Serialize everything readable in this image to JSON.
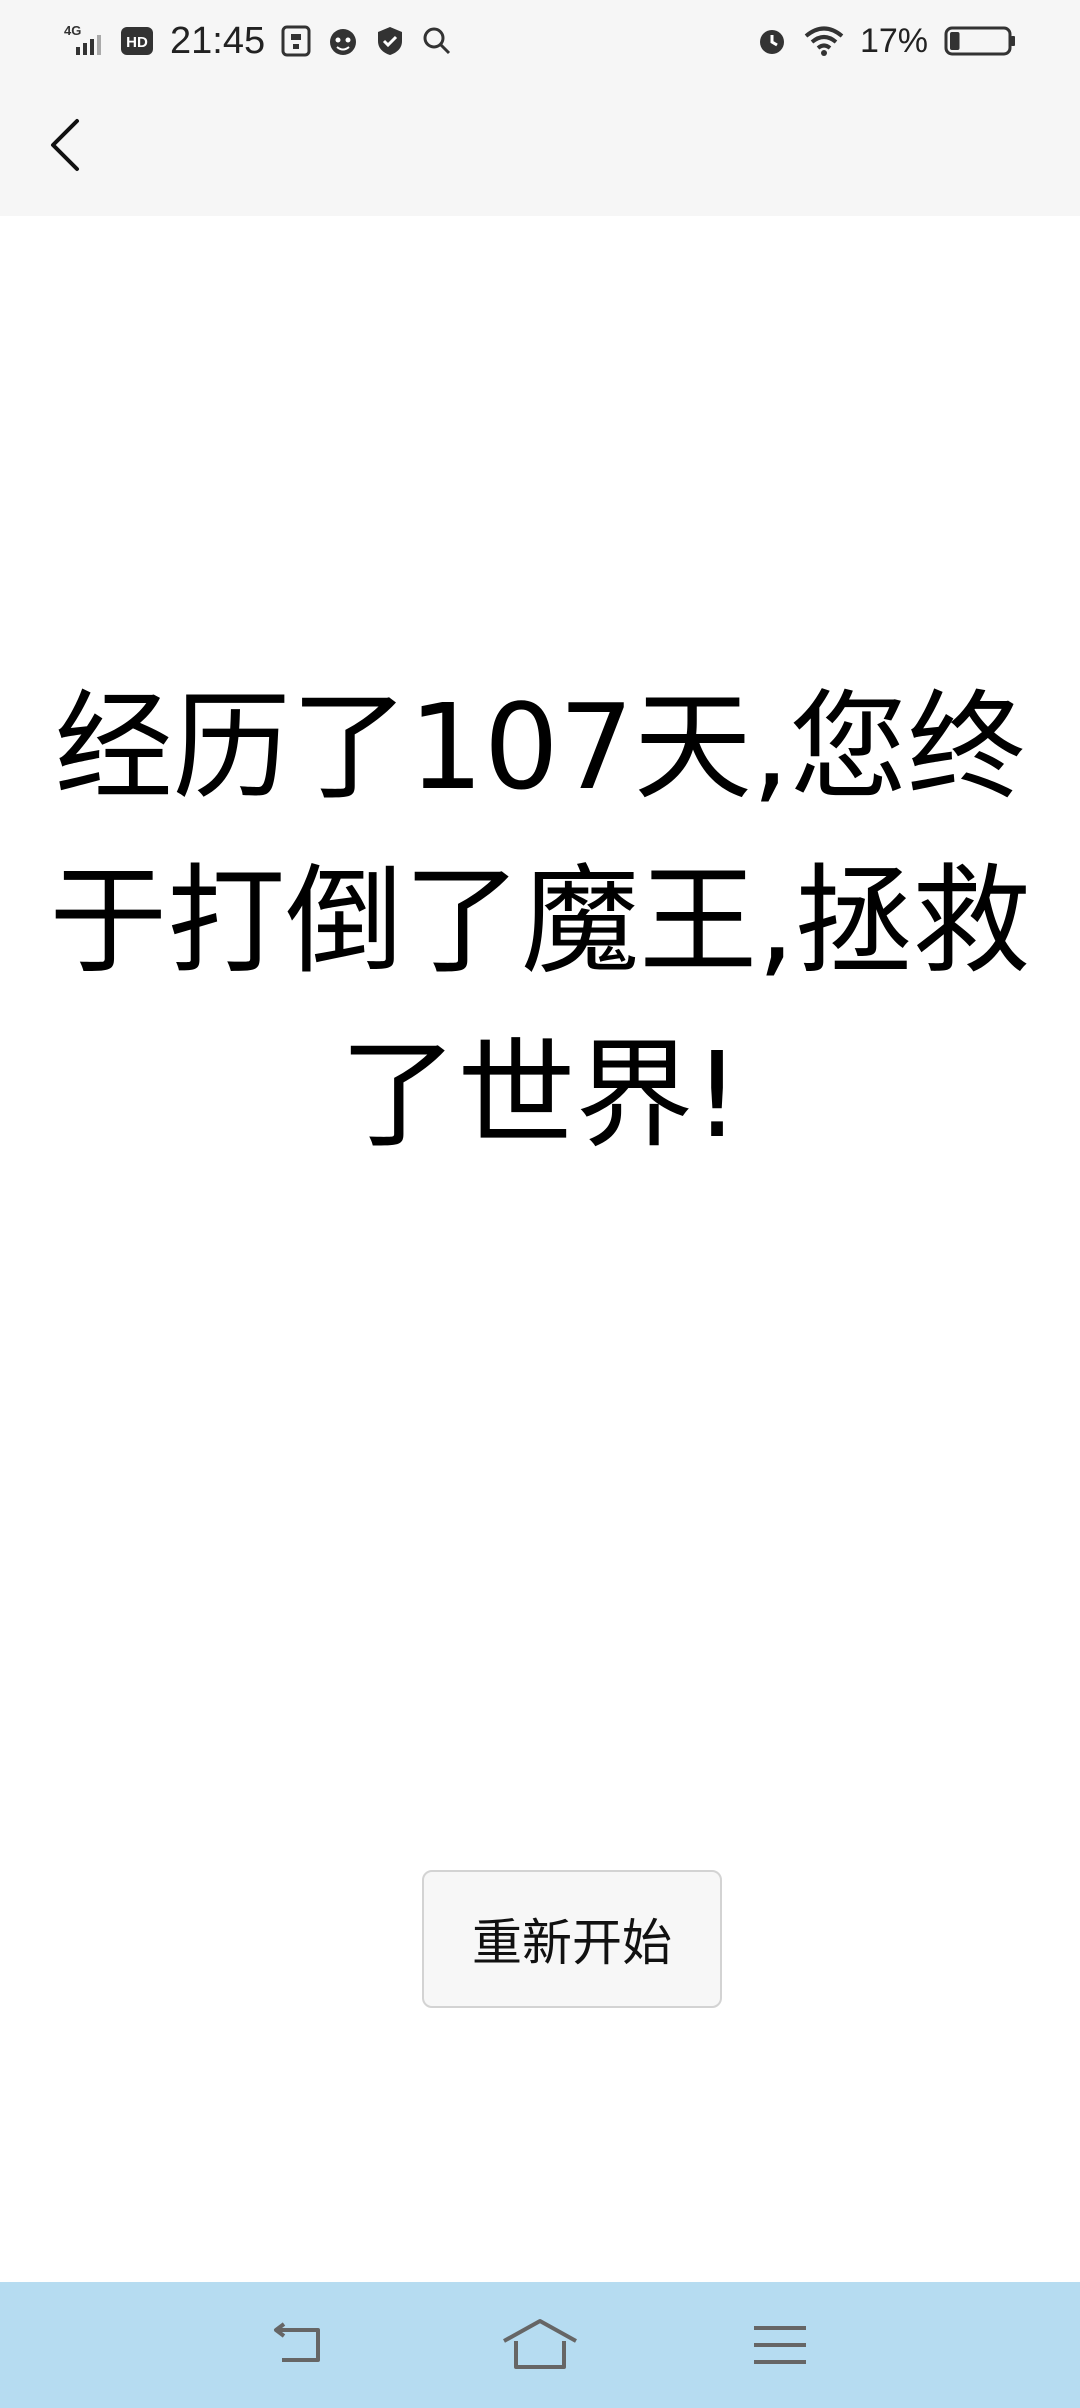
{
  "status_bar": {
    "network": "4G",
    "hd": "HD",
    "time": "21:45",
    "battery_percent": "17%",
    "battery_level": 0.17,
    "icons": [
      "signal-icon",
      "hd-icon",
      "sim-icon",
      "face-icon",
      "shield-icon",
      "search-icon",
      "alarm-icon",
      "wifi-icon",
      "battery-icon"
    ]
  },
  "toolbar": {
    "back_icon": "chevron-left-icon"
  },
  "main": {
    "message": "经历了107天,您终于打倒了魔王,拯救了世界!",
    "restart_label": "重新开始"
  },
  "nav_bar": {
    "background": "#b6dcf1",
    "icons": [
      "back-nav-icon",
      "home-icon",
      "menu-icon"
    ]
  }
}
